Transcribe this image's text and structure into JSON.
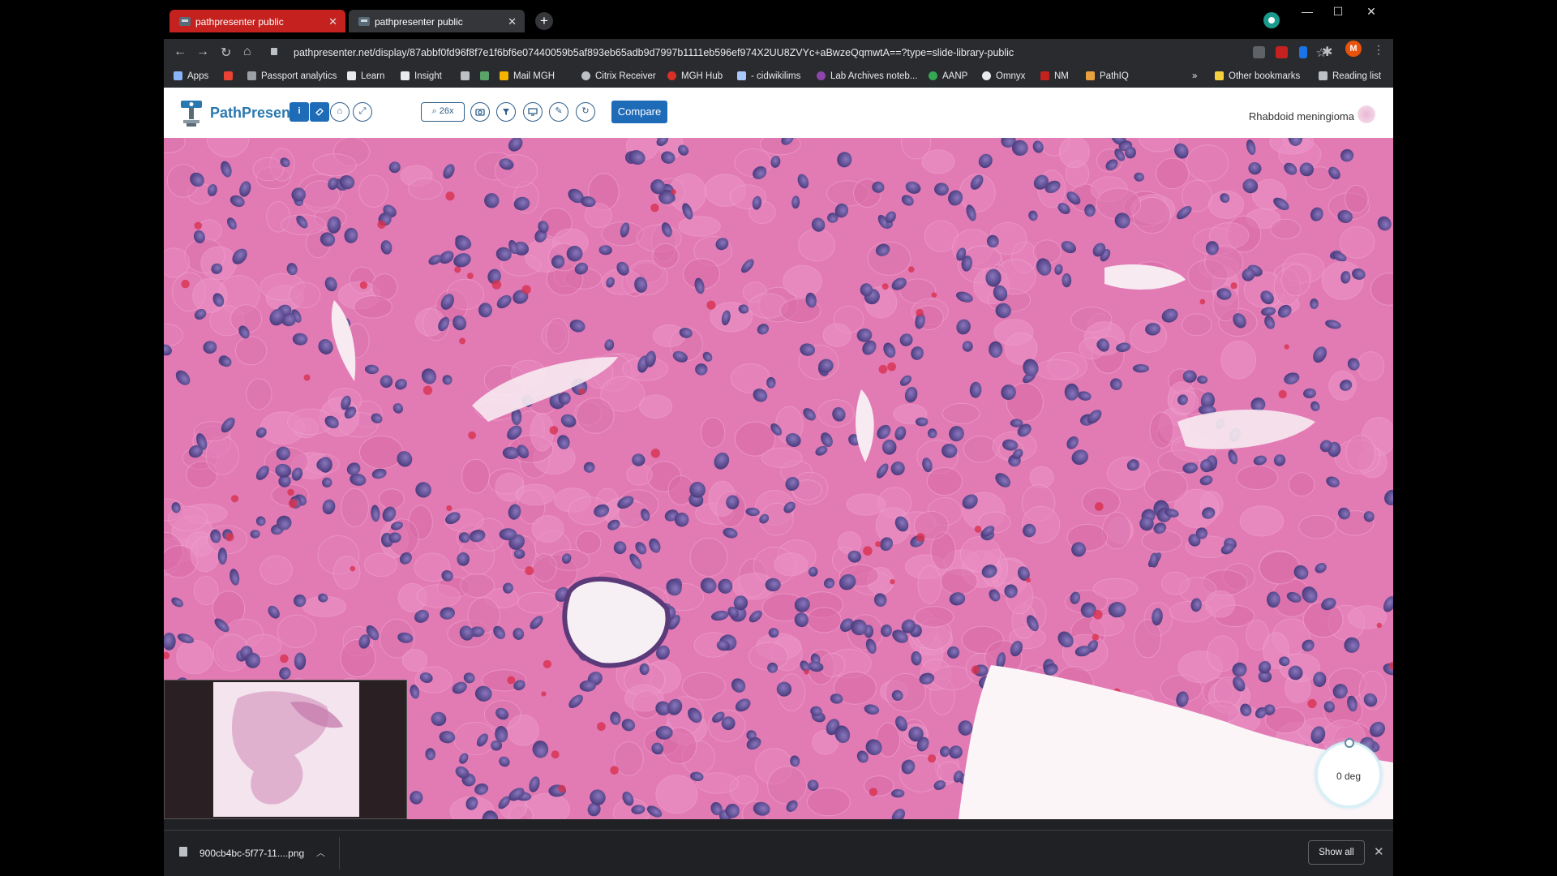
{
  "browser": {
    "tabs": [
      {
        "title": "pathpresenter public",
        "active": true
      },
      {
        "title": "pathpresenter public",
        "active": false
      }
    ],
    "new_tab_label": "+",
    "url": "pathpresenter.net/display/87abbf0fd96f8f7e1f6bf6e07440059b5af893eb65adb9d7997b1111eb596ef974X2UU8ZVYc+aBwzeQqmwtA==?type=slide-library-public",
    "profile_initial": "M",
    "window_controls": {
      "minimize": "—",
      "maximize": "☐",
      "close": "✕"
    },
    "bookmarks": [
      {
        "label": "Apps",
        "color": "#8ab4f8"
      },
      {
        "label": "",
        "color": "#ea4335"
      },
      {
        "label": "Passport analytics",
        "color": "#9aa0a6"
      },
      {
        "label": "Learn",
        "color": "#e8eaed"
      },
      {
        "label": "Insight",
        "color": "#e8eaed"
      },
      {
        "label": "",
        "color": "#bdc1c6"
      },
      {
        "label": "",
        "color": "#5aa469"
      },
      {
        "label": "Mail MGH",
        "color": "#f4b400"
      },
      {
        "label": "Citrix Receiver",
        "color": "#bdc1c6"
      },
      {
        "label": "MGH Hub",
        "color": "#d93025"
      },
      {
        "label": "- cidwikilims",
        "color": "#a8c7fa"
      },
      {
        "label": "Lab Archives noteb...",
        "color": "#8e44ad"
      },
      {
        "label": "AANP",
        "color": "#34a853"
      },
      {
        "label": "Omnyx",
        "color": "#e8eaed"
      },
      {
        "label": "NM",
        "color": "#c5221f"
      },
      {
        "label": "PathIQ",
        "color": "#e8a13c"
      }
    ],
    "bookmarks_overflow": "»",
    "other_bookmarks": "Other bookmarks",
    "reading_list": "Reading list"
  },
  "app": {
    "brand": "PathPresenter",
    "toolbar": {
      "info": "i",
      "zoom_label": "26x",
      "compare_label": "Compare"
    },
    "slide_title": "Rhabdoid meningioma",
    "rotation_label": "0 deg"
  },
  "downloads": {
    "filename": "900cb4bc-5f77-11....png",
    "show_all": "Show all"
  },
  "colors": {
    "tab_active": "#c5221f",
    "brand_blue": "#2a78b0",
    "button_blue": "#1e6bb8",
    "tissue_base": "#e27bb4",
    "nucleus": "#5a4a8e"
  }
}
